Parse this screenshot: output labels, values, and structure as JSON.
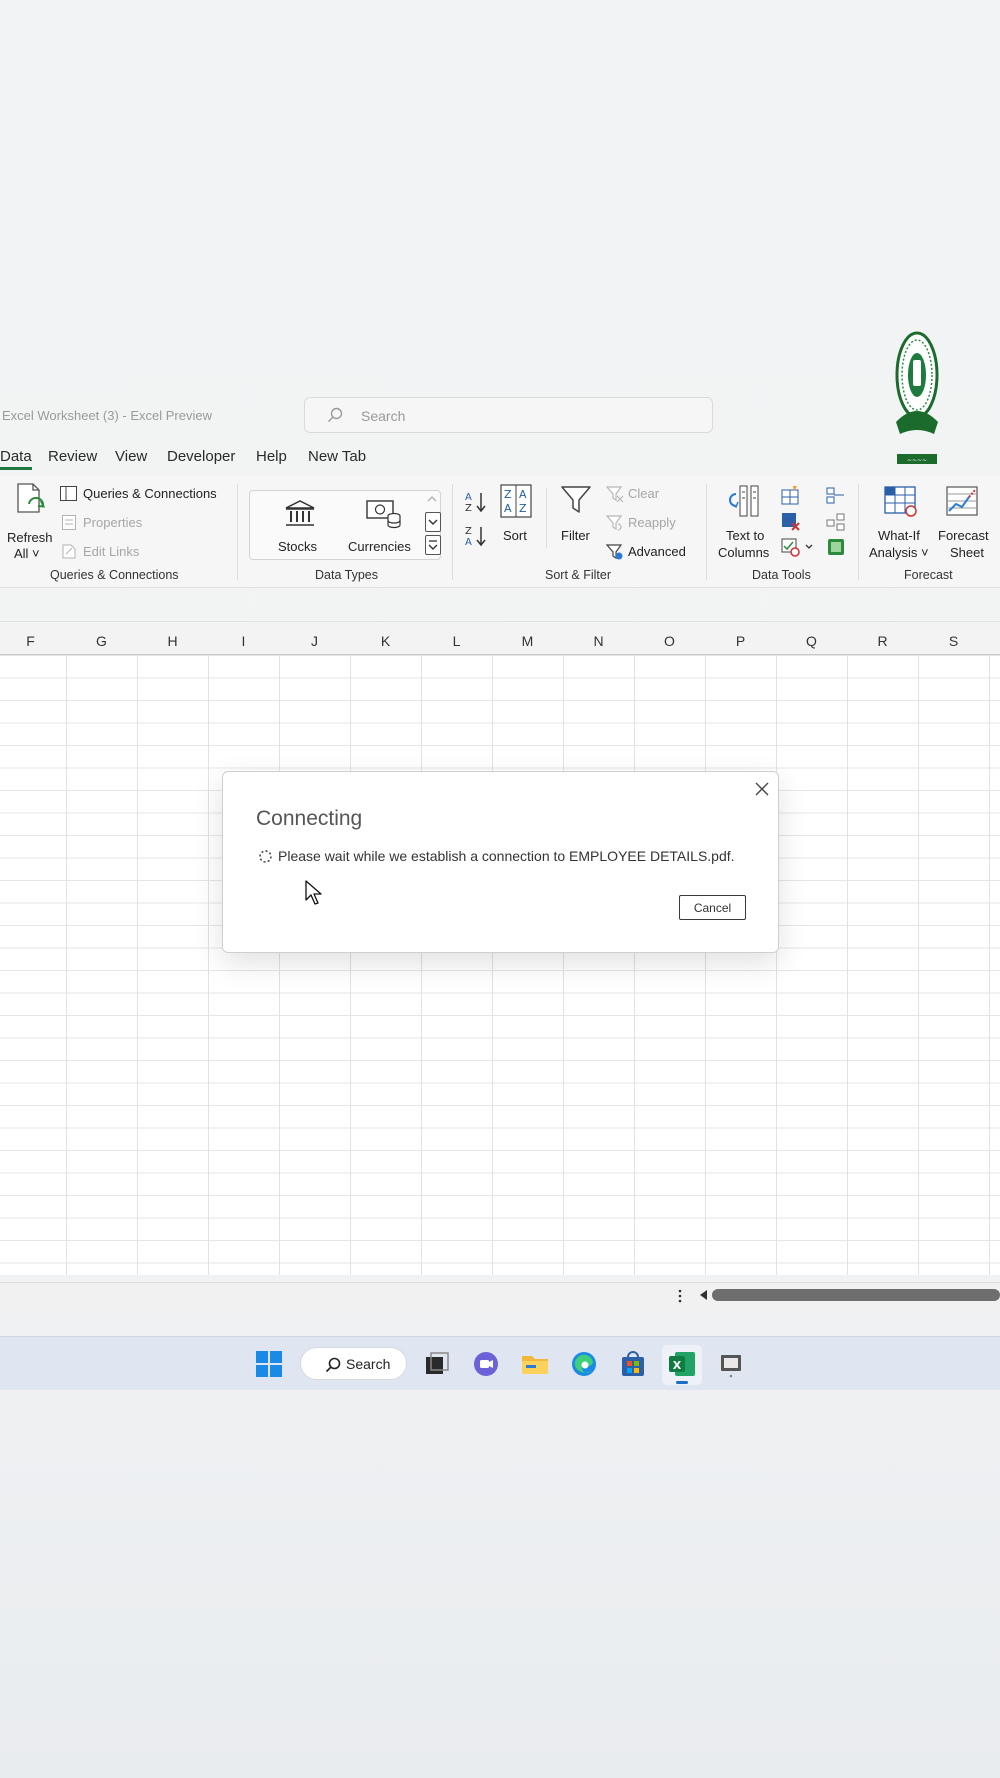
{
  "window": {
    "title": "Excel Worksheet (3)  -  Excel Preview",
    "search_placeholder": "Search"
  },
  "tabs": [
    {
      "label": "Data",
      "active": true
    },
    {
      "label": "Review"
    },
    {
      "label": "View"
    },
    {
      "label": "Developer"
    },
    {
      "label": "Help"
    },
    {
      "label": "New Tab"
    }
  ],
  "ribbon": {
    "queries": {
      "refresh_line1": "Refresh",
      "refresh_line2": "All ˅",
      "queries_connections": "Queries & Connections",
      "properties": "Properties",
      "edit_links": "Edit Links",
      "group_label": "Queries & Connections"
    },
    "datatypes": {
      "stocks": "Stocks",
      "currencies": "Currencies",
      "group_label": "Data Types"
    },
    "sortfilter": {
      "sort": "Sort",
      "filter": "Filter",
      "clear": "Clear",
      "reapply": "Reapply",
      "advanced": "Advanced",
      "group_label": "Sort & Filter"
    },
    "datatools": {
      "text_to_columns_line1": "Text to",
      "text_to_columns_line2": "Columns",
      "group_label": "Data Tools"
    },
    "forecast": {
      "whatif_line1": "What-If",
      "whatif_line2": "Analysis ˅",
      "forecast_line1": "Forecast",
      "forecast_line2": "Sheet",
      "group_label": "Forecast"
    }
  },
  "columns": [
    "F",
    "G",
    "H",
    "I",
    "J",
    "K",
    "L",
    "M",
    "N",
    "O",
    "P",
    "Q",
    "R",
    "S"
  ],
  "dialog": {
    "title": "Connecting",
    "message": "Please wait while we establish a connection to EMPLOYEE DETAILS.pdf.",
    "cancel_label": "Cancel"
  },
  "taskbar": {
    "search_label": "Search"
  },
  "colors": {
    "excel_green": "#1f7a3f",
    "accent_blue": "#2b7cd3",
    "taskbar_bg": "#dfe6f1"
  }
}
